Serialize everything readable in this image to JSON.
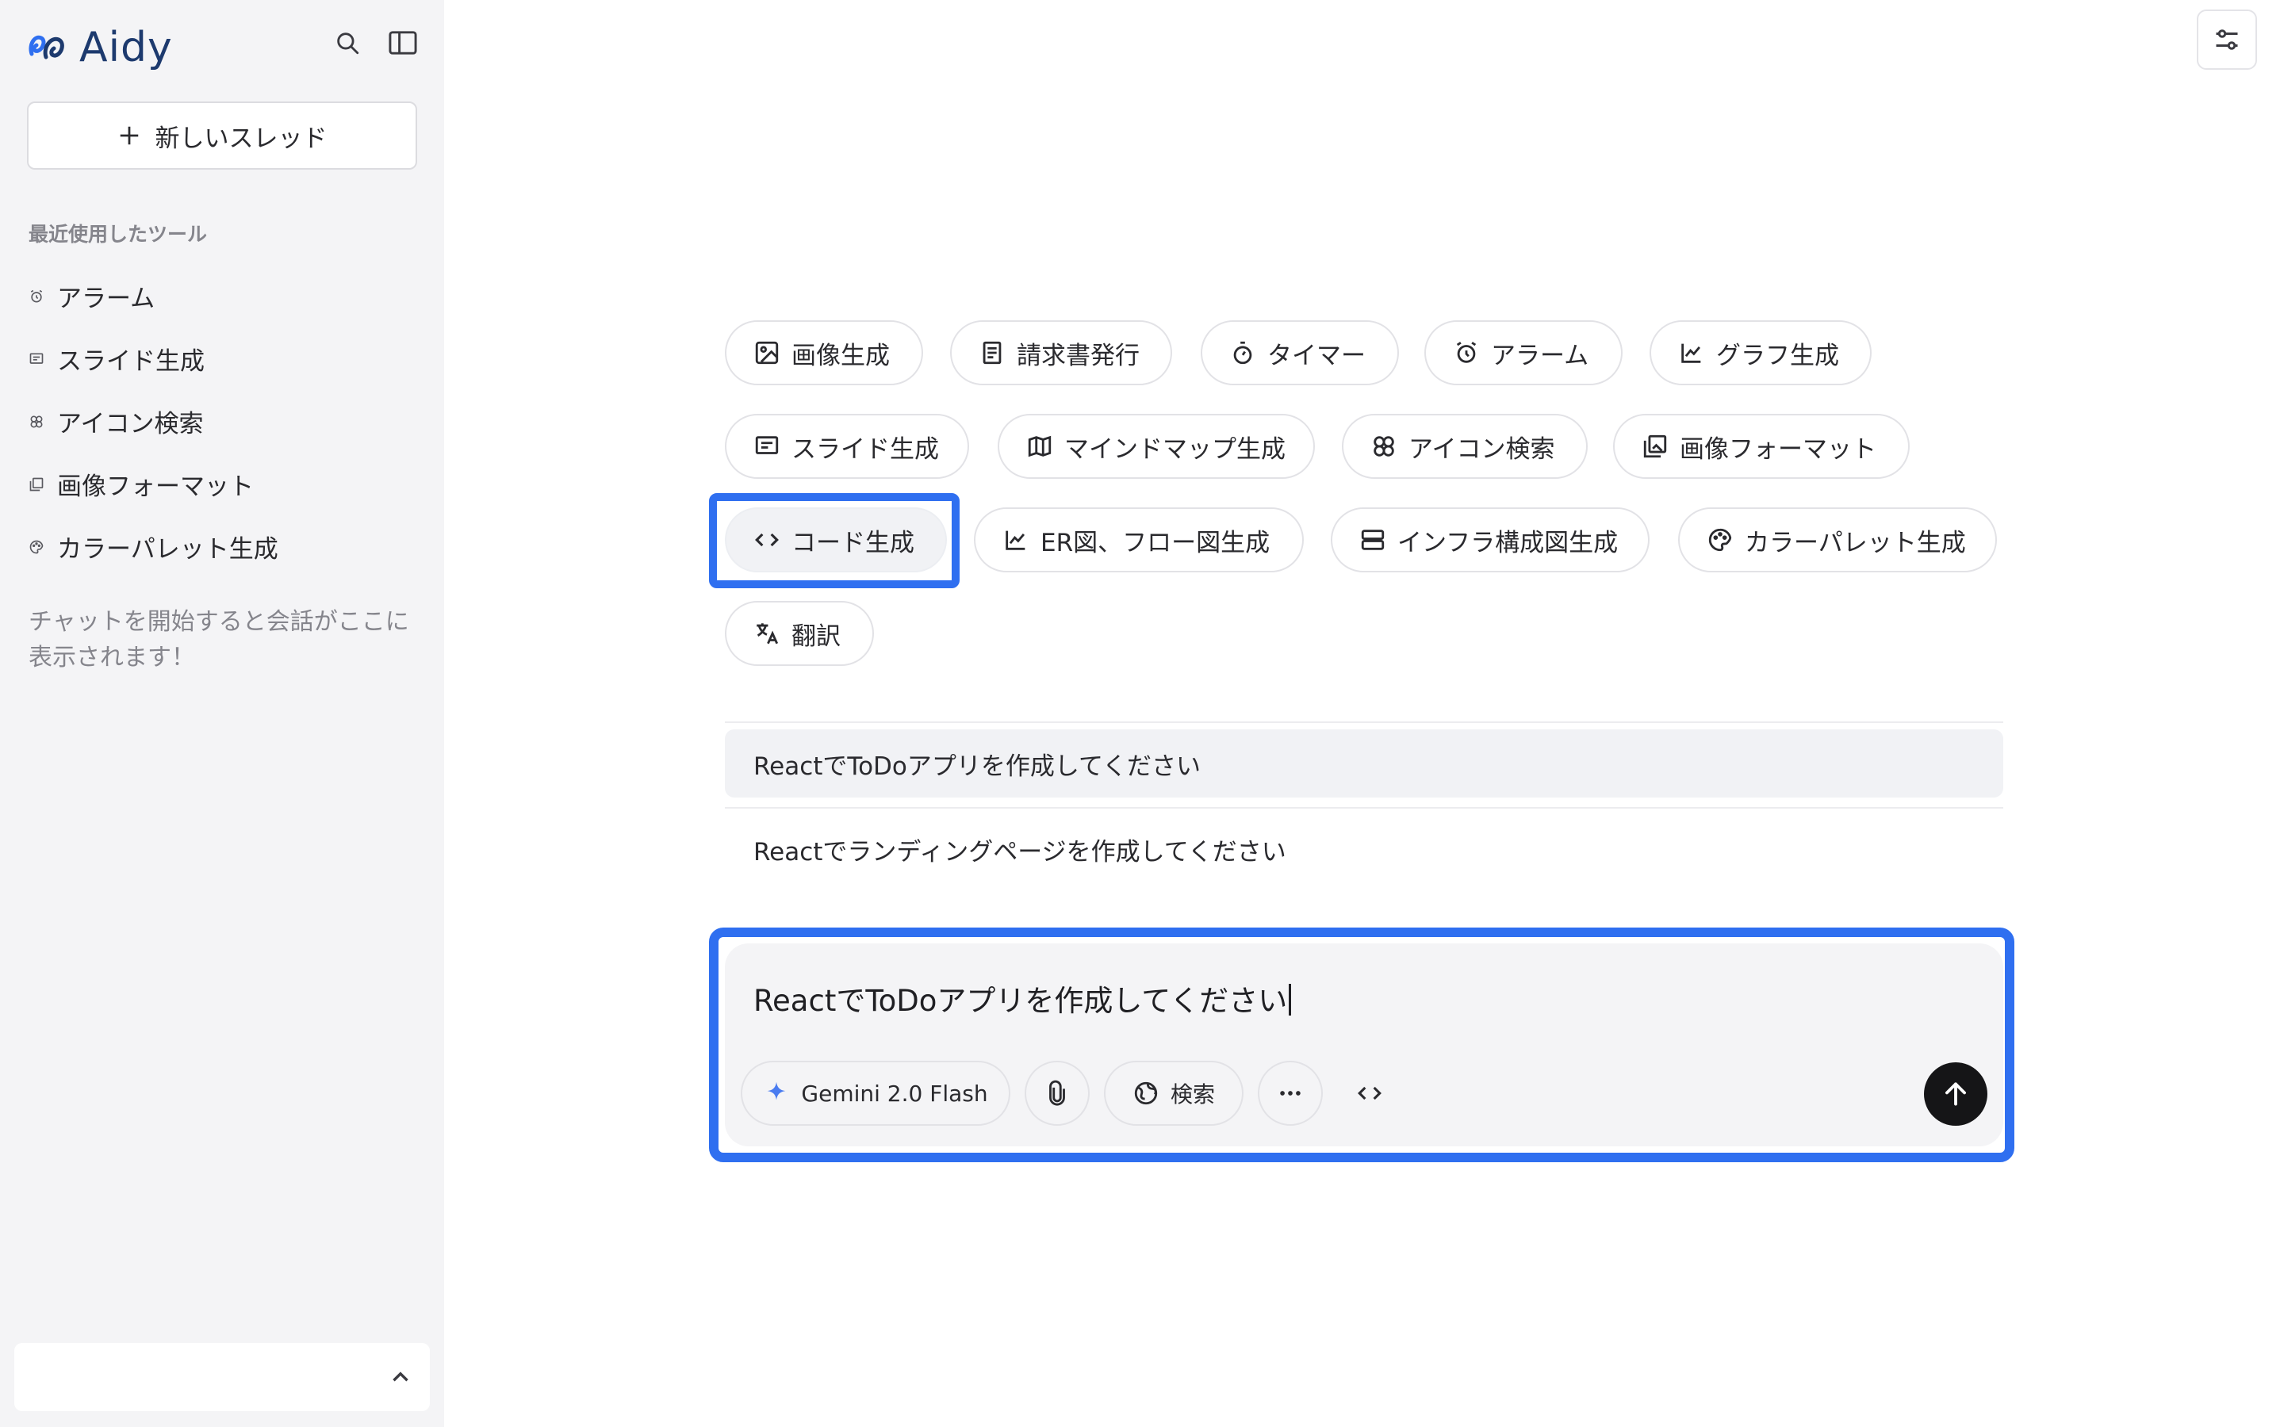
{
  "app": {
    "name": "Aidy",
    "brand_color": "#1d3a6e"
  },
  "sidebar": {
    "new_thread_label": "新しいスレッド",
    "recent_title": "最近使用したツール",
    "recent_items": [
      {
        "label": "アラーム",
        "icon": "alarm-icon"
      },
      {
        "label": "スライド生成",
        "icon": "slide-icon"
      },
      {
        "label": "アイコン検索",
        "icon": "icon-search-icon"
      },
      {
        "label": "画像フォーマット",
        "icon": "image-format-icon"
      },
      {
        "label": "カラーパレット生成",
        "icon": "palette-icon"
      }
    ],
    "empty_note": "チャットを開始すると会話がここに表示されます！"
  },
  "tools": [
    {
      "label": "画像生成",
      "icon": "image-icon"
    },
    {
      "label": "請求書発行",
      "icon": "invoice-icon"
    },
    {
      "label": "タイマー",
      "icon": "timer-icon"
    },
    {
      "label": "アラーム",
      "icon": "alarm-icon"
    },
    {
      "label": "グラフ生成",
      "icon": "chart-icon"
    },
    {
      "label": "スライド生成",
      "icon": "slide-icon"
    },
    {
      "label": "マインドマップ生成",
      "icon": "map-icon"
    },
    {
      "label": "アイコン検索",
      "icon": "icon-search-icon"
    },
    {
      "label": "画像フォーマット",
      "icon": "image-format-icon"
    },
    {
      "label": "コード生成",
      "icon": "code-icon",
      "selected": true
    },
    {
      "label": "ER図、フロー図生成",
      "icon": "chart-icon"
    },
    {
      "label": "インフラ構成図生成",
      "icon": "server-icon"
    },
    {
      "label": "カラーパレット生成",
      "icon": "palette-icon"
    },
    {
      "label": "翻訳",
      "icon": "translate-icon"
    }
  ],
  "suggestions": [
    "ReactでToDoアプリを作成してください",
    "Reactでランディングページを作成してください"
  ],
  "composer": {
    "value": "ReactでToDoアプリを作成してください",
    "model_label": "Gemini 2.0 Flash",
    "search_label": "検索"
  },
  "colors": {
    "highlight": "#2f6ff0",
    "send": "#151517"
  }
}
